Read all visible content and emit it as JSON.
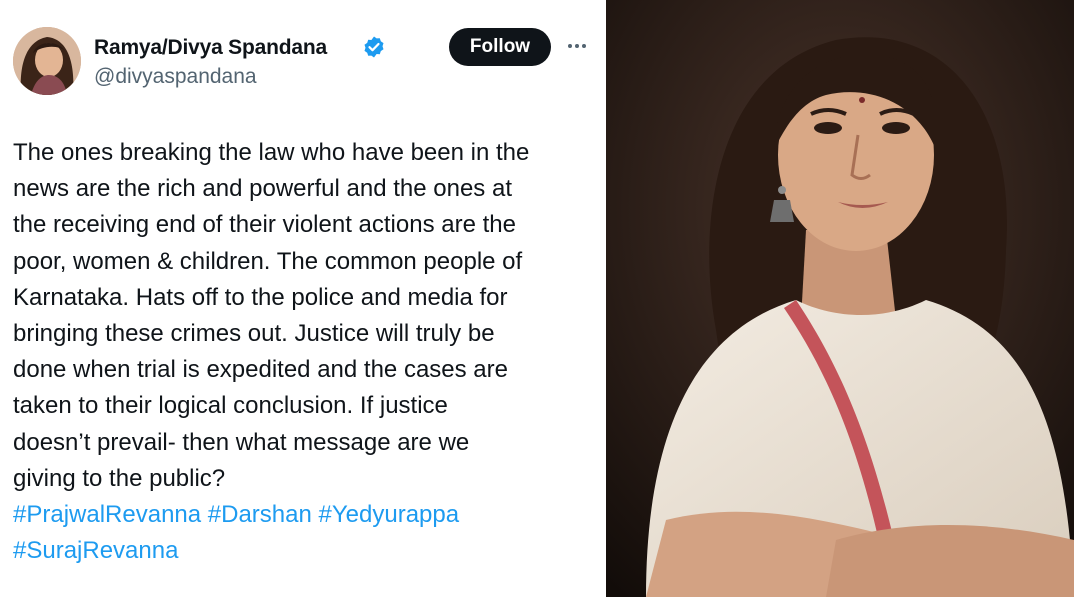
{
  "tweet": {
    "author": {
      "display_name": "Ramya/Divya Spandana",
      "handle": "@divyaspandana",
      "verified": true
    },
    "follow_label": "Follow",
    "more_icon": "more-horizontal-icon",
    "text_lines": [
      "The ones breaking the law who have been in the",
      "news are the rich and powerful and the ones at",
      "the receiving end of their violent  actions are the",
      "poor, women & children. The common people of",
      "Karnataka. Hats off to the police and media for",
      "bringing these crimes out. Justice will truly be",
      "done when trial is expedited and the cases are",
      "taken to their logical conclusion. If justice",
      "doesn’t prevail- then what message are we",
      "giving to the public?"
    ],
    "hashtags_line1": [
      "#PrajwalRevanna",
      "#Darshan",
      "#Yedyurappa"
    ],
    "hashtags_line2": [
      "#SurajRevanna"
    ]
  },
  "colors": {
    "text": "#0f1419",
    "secondary": "#536471",
    "link": "#1d9bf0",
    "follow_bg": "#0f1419",
    "verified": "#1d9bf0"
  }
}
